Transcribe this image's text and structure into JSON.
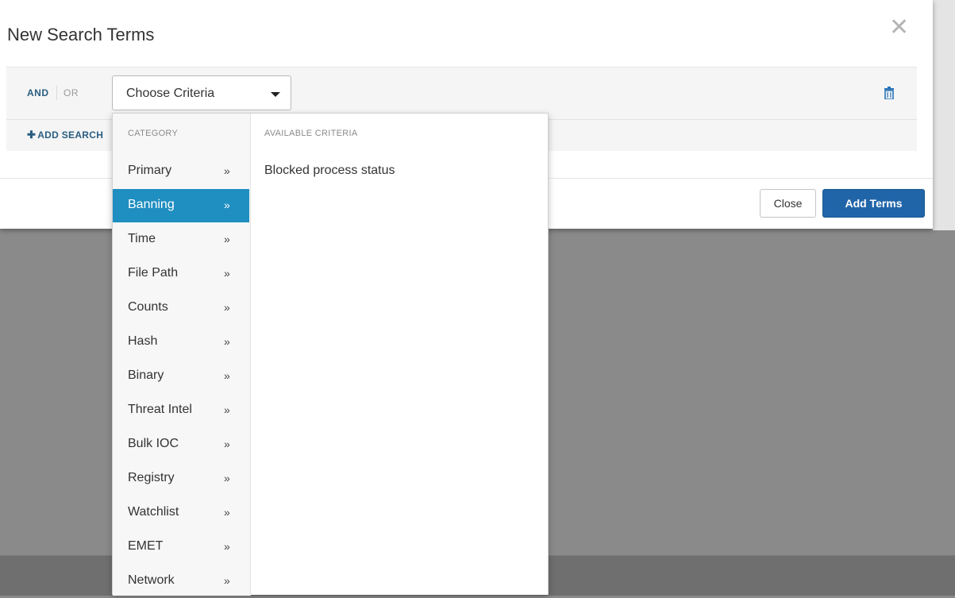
{
  "modal": {
    "title": "New Search Terms",
    "close_icon": "close-icon"
  },
  "criteria_row": {
    "and_label": "AND",
    "or_label": "OR",
    "dropdown_label": "Choose Criteria",
    "add_search_label": "ADD SEARCH",
    "delete_icon": "trash-icon"
  },
  "dropdown": {
    "category_header": "CATEGORY",
    "criteria_header": "AVAILABLE CRITERIA",
    "categories": [
      {
        "label": "Primary",
        "arrow": "»",
        "active": false
      },
      {
        "label": "Banning",
        "arrow": "»",
        "active": true
      },
      {
        "label": "Time",
        "arrow": "»",
        "active": false
      },
      {
        "label": "File Path",
        "arrow": "»",
        "active": false
      },
      {
        "label": "Counts",
        "arrow": "»",
        "active": false
      },
      {
        "label": "Hash",
        "arrow": "»",
        "active": false
      },
      {
        "label": "Binary",
        "arrow": "»",
        "active": false
      },
      {
        "label": "Threat Intel",
        "arrow": "»",
        "active": false
      },
      {
        "label": "Bulk IOC",
        "arrow": "»",
        "active": false
      },
      {
        "label": "Registry",
        "arrow": "»",
        "active": false
      },
      {
        "label": "Watchlist",
        "arrow": "»",
        "active": false
      },
      {
        "label": "EMET",
        "arrow": "»",
        "active": false
      },
      {
        "label": "Network",
        "arrow": "»",
        "active": false
      }
    ],
    "criteria": [
      "Blocked process status"
    ]
  },
  "footer": {
    "close_label": "Close",
    "add_terms_label": "Add Terms"
  },
  "colors": {
    "accent_active": "#1f8ec0",
    "primary_button": "#2165a9",
    "link": "#2a5d80"
  }
}
